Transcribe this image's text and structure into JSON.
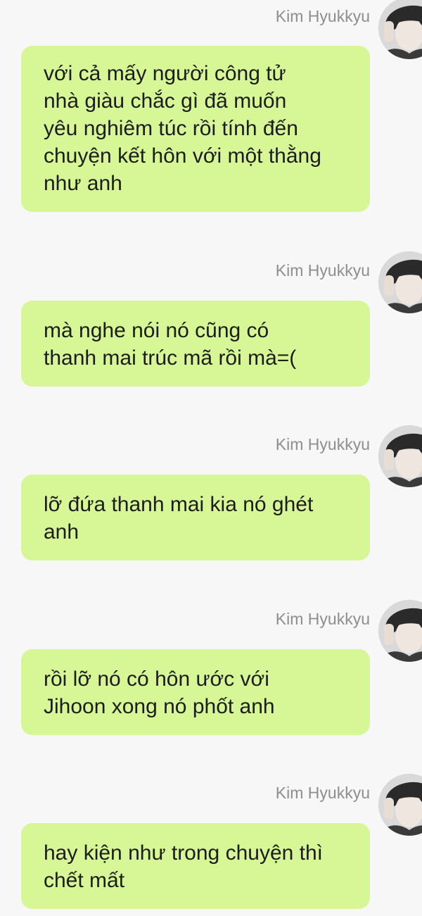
{
  "chat": {
    "messages": [
      {
        "sender": "Kim Hyukkyu",
        "avatar_icon": "user-avatar-icon",
        "lines": [
          "với cả mấy người công tử",
          "nhà giàu chắc gì đã muốn",
          "yêu nghiêm túc rồi tính đến",
          "chuyện kết hôn với một thằng",
          "như anh"
        ]
      },
      {
        "sender": "Kim Hyukkyu",
        "avatar_icon": "user-avatar-icon",
        "lines": [
          "mà nghe nói nó cũng có",
          "thanh mai trúc mã rồi mà=("
        ]
      },
      {
        "sender": "Kim Hyukkyu",
        "avatar_icon": "user-avatar-icon",
        "lines": [
          "lỡ đứa thanh mai kia nó ghét",
          "anh"
        ]
      },
      {
        "sender": "Kim Hyukkyu",
        "avatar_icon": "user-avatar-icon",
        "lines": [
          "rồi lỡ nó có hôn ước với",
          "Jihoon xong nó phốt anh"
        ]
      },
      {
        "sender": "Kim Hyukkyu",
        "avatar_icon": "user-avatar-icon",
        "lines": [
          "hay kiện như trong chuyện thì",
          "chết mất"
        ]
      }
    ]
  },
  "colors": {
    "background": "#f7f7f7",
    "bubble": "#d7f796",
    "sender_name": "#8e8e8e",
    "message_text": "#1c1c1c"
  }
}
